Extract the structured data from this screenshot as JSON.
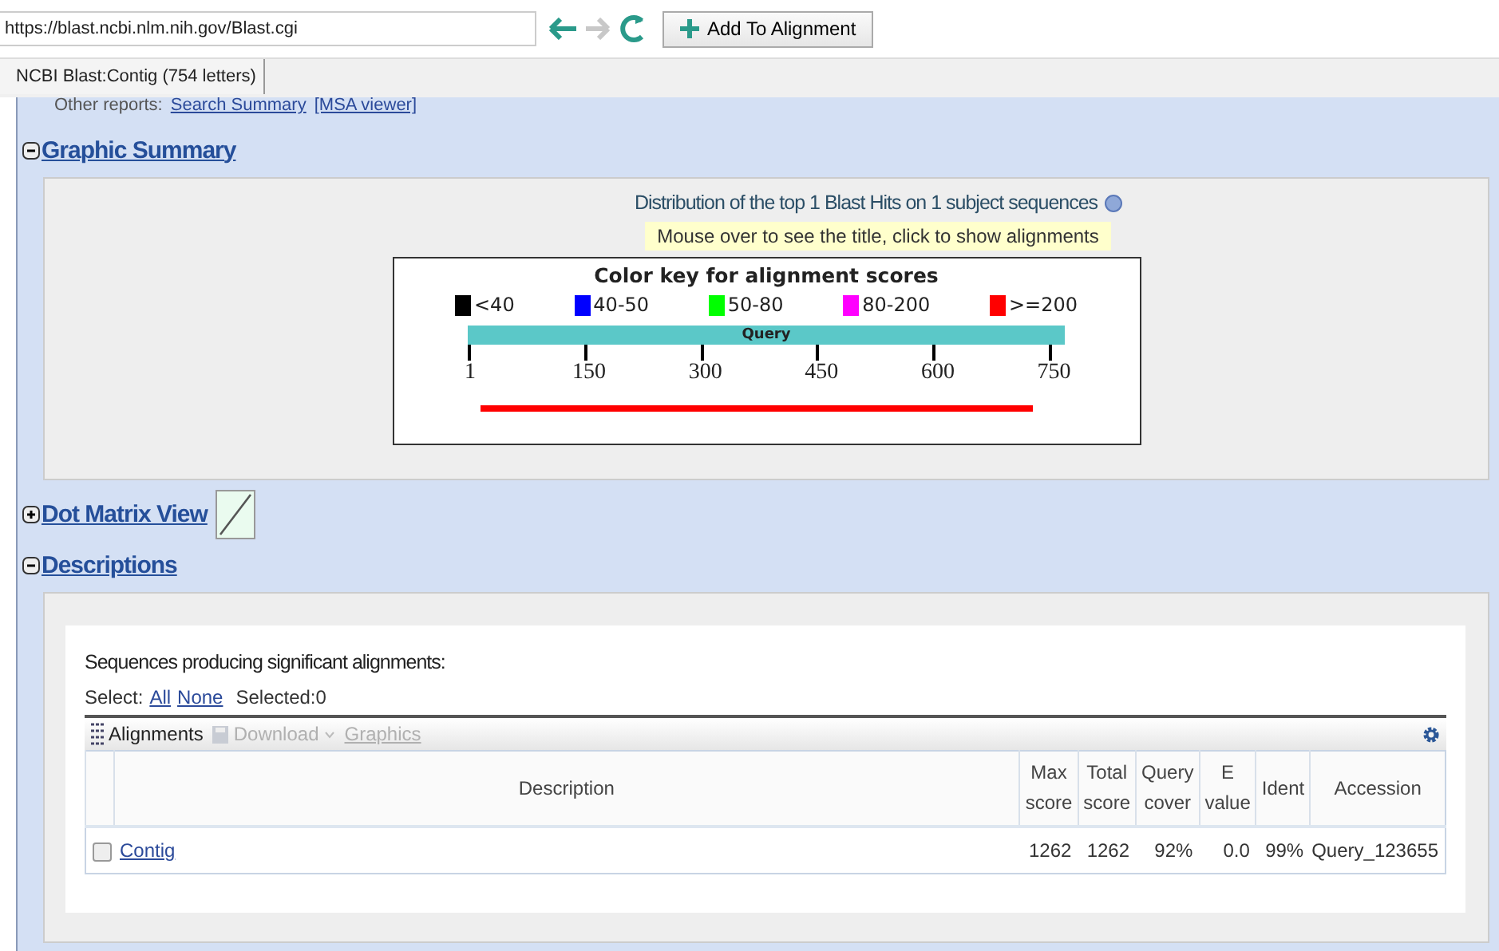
{
  "browser": {
    "address": "https://blast.ncbi.nlm.nih.gov/Blast.cgi",
    "add_button": "Add To Alignment",
    "tab": "NCBI Blast:Contig (754 letters)"
  },
  "other_reports": {
    "label": "Other reports:",
    "links": [
      "Search Summary",
      "[MSA viewer]"
    ]
  },
  "sections": [
    {
      "title": "Graphic Summary",
      "expanded": true
    },
    {
      "title": "Dot Matrix View",
      "expanded": false
    },
    {
      "title": "Descriptions",
      "expanded": true
    }
  ],
  "graphic_summary": {
    "title": "Distribution of the top 1 Blast Hits on 1 subject sequences",
    "hint": "Mouse over to see the title, click to show alignments",
    "key_title": "Color key for alignment scores",
    "key": [
      {
        "label": "<40",
        "color": "#000000"
      },
      {
        "label": "40-50",
        "color": "#0000ff"
      },
      {
        "label": "50-80",
        "color": "#00ff00"
      },
      {
        "label": "80-200",
        "color": "#ff00ff"
      },
      {
        "label": ">=200",
        "color": "#ff0000"
      }
    ],
    "query_label": "Query",
    "ticks": [
      "1",
      "150",
      "300",
      "450",
      "600",
      "750"
    ],
    "hits": [
      {
        "color": "#ff0000"
      }
    ]
  },
  "descriptions": {
    "heading": "Sequences producing significant alignments:",
    "select_label": "Select:",
    "select_links": [
      "All",
      "None"
    ],
    "selected": "Selected:0",
    "toolbar": [
      {
        "label": "Alignments",
        "disabled": false,
        "kind": "alignments"
      },
      {
        "label": "Download",
        "disabled": true,
        "kind": "download"
      },
      {
        "label": "Graphics",
        "disabled": true,
        "kind": "link"
      }
    ],
    "columns": [
      {
        "label": "Description"
      },
      {
        "label": "Max score"
      },
      {
        "label": "Total score"
      },
      {
        "label": "Query cover"
      },
      {
        "label": "E value"
      },
      {
        "label": "Ident"
      },
      {
        "label": "Accession"
      }
    ],
    "rows": [
      {
        "checked": false,
        "cells": [
          "Contig",
          "1262",
          "1262",
          "92%",
          "0.0",
          "99%",
          "Query_123655"
        ]
      }
    ]
  }
}
